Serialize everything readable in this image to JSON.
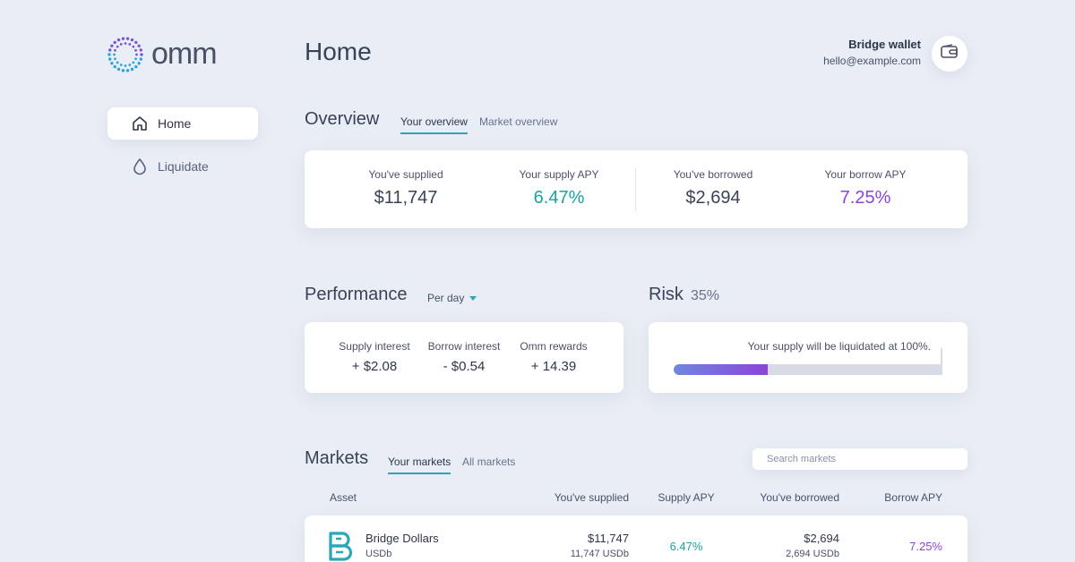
{
  "brand": {
    "name": "omm"
  },
  "sidebar": {
    "items": [
      {
        "label": "Home",
        "icon": "home-icon",
        "active": true
      },
      {
        "label": "Liquidate",
        "icon": "drop-icon",
        "active": false
      }
    ]
  },
  "header": {
    "title": "Home",
    "wallet_name": "Bridge wallet",
    "wallet_email": "hello@example.com",
    "wallet_icon": "wallet-icon"
  },
  "overview": {
    "title": "Overview",
    "tabs": [
      {
        "label": "Your overview",
        "active": true
      },
      {
        "label": "Market overview",
        "active": false
      }
    ],
    "stats": [
      {
        "label": "You've supplied",
        "value": "$11,747"
      },
      {
        "label": "Your supply APY",
        "value": "6.47%"
      },
      {
        "label": "You've borrowed",
        "value": "$2,694"
      },
      {
        "label": "Your borrow APY",
        "value": "7.25%"
      }
    ]
  },
  "performance": {
    "title": "Performance",
    "period": "Per day",
    "stats": [
      {
        "label": "Supply interest",
        "value": "+ $2.08"
      },
      {
        "label": "Borrow interest",
        "value": "- $0.54"
      },
      {
        "label": "Omm rewards",
        "value": "+ 14.39"
      }
    ]
  },
  "risk": {
    "title": "Risk",
    "percent": "35%",
    "level": 0.35,
    "note": "Your supply will be liquidated at 100%."
  },
  "markets": {
    "title": "Markets",
    "tabs": [
      {
        "label": "Your markets",
        "active": true
      },
      {
        "label": "All markets",
        "active": false
      }
    ],
    "search_placeholder": "Search markets",
    "columns": [
      "Asset",
      "You've supplied",
      "Supply APY",
      "You've borrowed",
      "Borrow APY"
    ],
    "rows": [
      {
        "asset": "Bridge Dollars",
        "symbol": "USDb",
        "supplied": "$11,747",
        "supplied_units": "11,747 USDb",
        "supply_apy": "6.47%",
        "borrowed": "$2,694",
        "borrowed_units": "2,694 USDb",
        "borrow_apy": "7.25%"
      }
    ]
  },
  "colors": {
    "teal": "#19a3a1",
    "purple": "#8b45d8",
    "background": "#e9edf5"
  }
}
